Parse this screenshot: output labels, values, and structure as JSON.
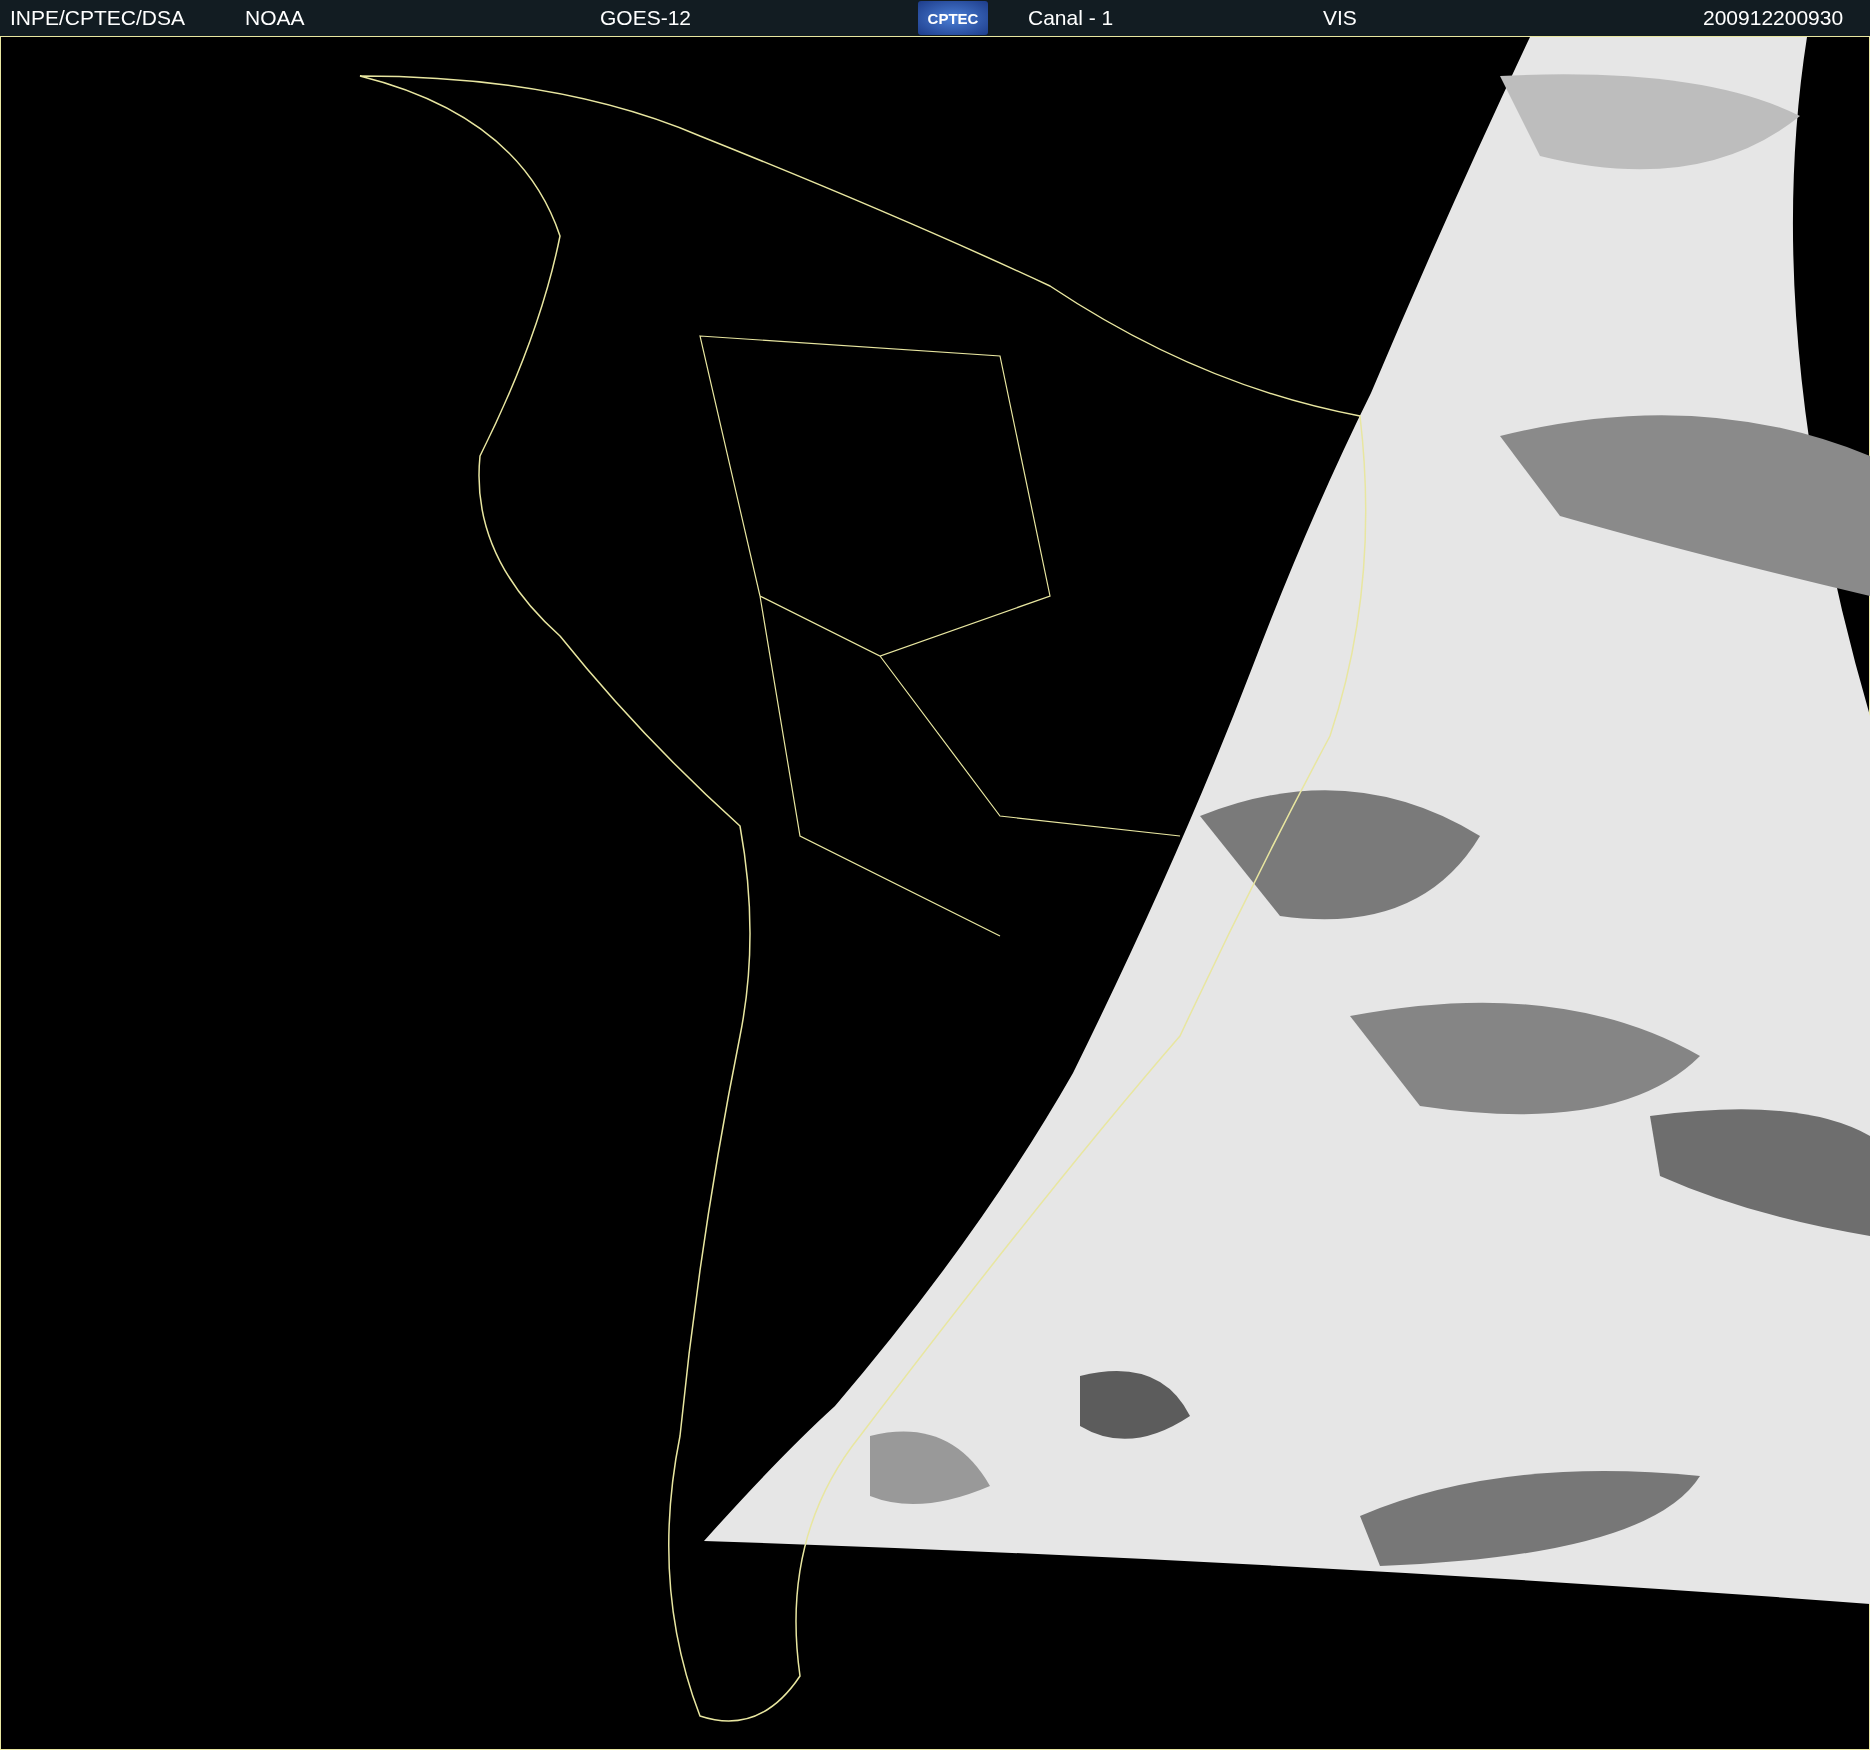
{
  "header": {
    "source": "INPE/CPTEC/DSA",
    "agency": "NOAA",
    "satellite": "GOES-12",
    "logo": "CPTEC",
    "channel": "Canal - 1",
    "band": "VIS",
    "timestamp": "200912200930"
  }
}
